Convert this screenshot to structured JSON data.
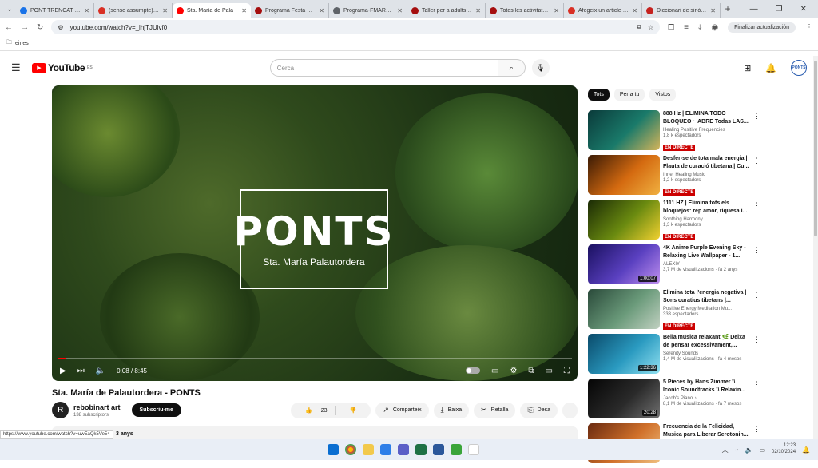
{
  "browser": {
    "tabs": [
      {
        "title": "PONT TRENCAT dimecres",
        "color": "#1a73e8",
        "active": false
      },
      {
        "title": "(sense assumpte) - albar",
        "color": "#d93025",
        "active": false
      },
      {
        "title": "Sta. María de Pala",
        "color": "#ff0000",
        "active": true
      },
      {
        "title": "Programa Festa Major",
        "color": "#a50e0e",
        "active": false
      },
      {
        "title": "Programa-FMAR24_1",
        "color": "#5f6368",
        "active": false
      },
      {
        "title": "Taller per a adults: Inf",
        "color": "#a50e0e",
        "active": false
      },
      {
        "title": "Totes les activitats - Bib",
        "color": "#a50e0e",
        "active": false
      },
      {
        "title": "Afegeix un article nou",
        "color": "#d93025",
        "active": false
      },
      {
        "title": "Diccionari de sinònims",
        "color": "#c5221f",
        "active": false
      }
    ],
    "url": "youtube.com/watch?v=_lhjTJUlvf0",
    "update_label": "Finalizar actualización",
    "bookmark": "eines",
    "status_url": "https://www.youtube.com/watch?v=uwEaQk5Ve54"
  },
  "yt": {
    "logo_text": "YouTube",
    "region": "ES",
    "search_placeholder": "Cerca",
    "avatar_text": "PONTS"
  },
  "video": {
    "title_overlay": "PONTS",
    "subtitle_overlay": "Sta. María Palautordera",
    "time": "0:08 / 8:45",
    "progress_fraction": 0.015,
    "title": "Sta. María de Palautordera - PONTS",
    "channel": "rebobinart art",
    "channel_initial": "R",
    "subscribers": "138 subscriptors",
    "subscribe_label": "Subscriu-me",
    "likes": "23",
    "share": "Comparteix",
    "download": "Baixa",
    "clip": "Retalla",
    "save": "Desa",
    "desc_age": "3 anys"
  },
  "chips": [
    "Tots",
    "Per a tu",
    "Vistos"
  ],
  "recommendations": [
    {
      "title": "888 Hz | ELIMINA TODO BLOQUEO ~ ABRE Todas LAS...",
      "channel": "Healing Positive Frequencies",
      "meta": "1,8 k espectadors",
      "live": "EN DIRECTE",
      "duration": "",
      "grad": "#0a3a3a,#1a7a6a,#d4b45a"
    },
    {
      "title": "Desfer-se de tota mala energia | Flauta de curació tibetana | Cu...",
      "channel": "Inner Healing Music",
      "meta": "1,2 k espectadors",
      "live": "EN DIRECTE",
      "duration": "",
      "grad": "#3a1a05,#d46a10,#f0b040"
    },
    {
      "title": "1111 HZ | Elimina tots els bloquejos: rep amor, riquesa i...",
      "channel": "Soothing Harmony",
      "meta": "1,3 k espectadors",
      "live": "EN DIRECTE",
      "duration": "",
      "grad": "#1a2a05,#6a8a10,#f0d030"
    },
    {
      "title": "4K Anime Purple Evening Sky - Relaxing Live Wallpaper - 1...",
      "channel": "ALEXIY",
      "meta": "3,7 M de visualitzacions · fa 2 anys",
      "live": "",
      "duration": "1:00:07",
      "grad": "#1a1060,#5a40c0,#c090f0"
    },
    {
      "title": "Elimina tota l'energia negativa | Sons curatius tibetans |...",
      "channel": "Positive Energy Meditation Mu...",
      "meta": "333 espectadors",
      "live": "EN DIRECTE",
      "duration": "",
      "grad": "#2a4a3a,#6a9a7a,#c0d0c0"
    },
    {
      "title": "Bella música relaxant 🌿 Deixa de pensar excessivament,...",
      "channel": "Serenity Sounds",
      "meta": "1,4 M de visualitzacions · fa 4 mesos",
      "live": "",
      "duration": "1:22:36",
      "grad": "#0a4a6a,#2a9ac0,#90e0f0"
    },
    {
      "title": "5 Pieces by Hans Zimmer \\\\ Iconic Soundtracks \\\\ Relaxin...",
      "channel": "Jacob's Piano ♪",
      "meta": "8,1 M de visualitzacions · fa 7 mesos",
      "live": "",
      "duration": "20:28",
      "grad": "#050505,#2a2a2a,#707070"
    },
    {
      "title": "Frecuencia de la Felicidad, Musica para Liberar Serotonin...",
      "channel": "",
      "meta": "",
      "live": "",
      "duration": "",
      "grad": "#6a2a10,#d0702a,#f0c080"
    }
  ],
  "taskbar": {
    "time": "12:23",
    "date": "02/10/2024"
  }
}
